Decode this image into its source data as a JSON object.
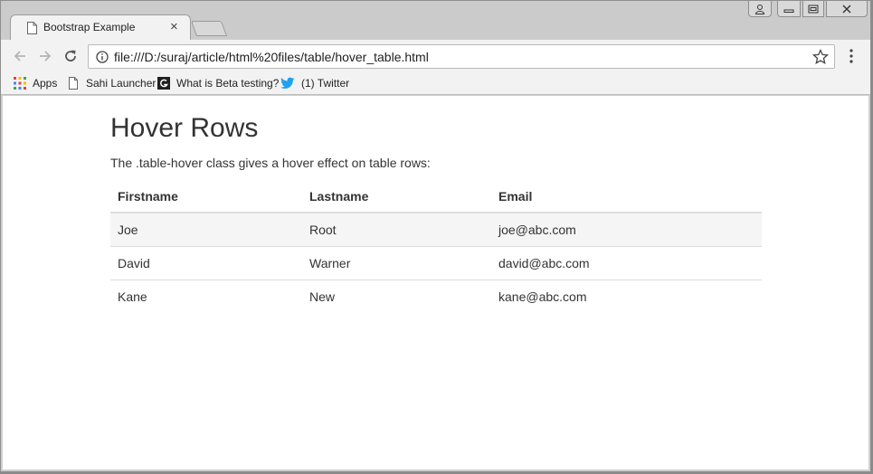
{
  "browser": {
    "tab": {
      "title": "Bootstrap Example",
      "close_glyph": "×"
    },
    "address_bar": {
      "url": "file:///D:/suraj/article/html%20files/table/hover_table.html"
    },
    "bookmarks": [
      {
        "label": "Apps",
        "icon": "apps-grid-icon"
      },
      {
        "label": "Sahi Launcher",
        "icon": "page-icon"
      },
      {
        "label": "What is Beta testing?",
        "icon": "g-logo-icon"
      },
      {
        "label": "(1) Twitter",
        "icon": "twitter-bird-icon"
      }
    ],
    "colors": {
      "chrome": "#cbcbcb",
      "toolbar": "#f2f2f2",
      "twitter": "#1da1f2"
    }
  },
  "page": {
    "heading": "Hover Rows",
    "description": "The .table-hover class gives a hover effect on table rows:",
    "table": {
      "headers": [
        "Firstname",
        "Lastname",
        "Email"
      ],
      "rows": [
        [
          "Joe",
          "Root",
          "joe@abc.com"
        ],
        [
          "David",
          "Warner",
          "david@abc.com"
        ],
        [
          "Kane",
          "New",
          "kane@abc.com"
        ]
      ],
      "hovered_row": 0,
      "hover_color": "#f5f5f5"
    }
  }
}
